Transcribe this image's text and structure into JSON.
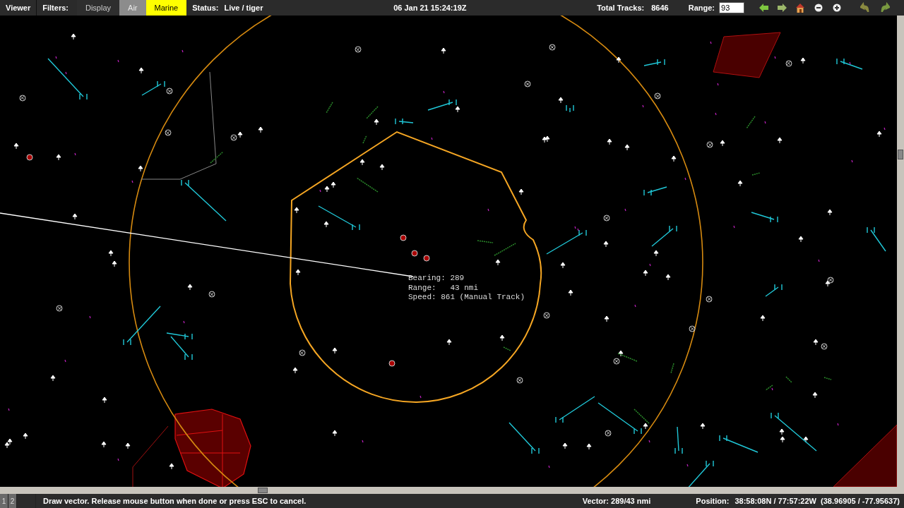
{
  "toolbar": {
    "menu": "Viewer",
    "filters_label": "Filters:",
    "filters": [
      {
        "label": "Display",
        "color": "#2e2e2e"
      },
      {
        "label": "Air",
        "color": "#8c8c8c"
      },
      {
        "label": "Marine",
        "color": "#ffff00"
      }
    ],
    "status_label": "Status:",
    "status": "Live / tiger",
    "datetime": "06 Jan 21 15:24:19Z",
    "tracks_label": "Total Tracks:",
    "tracks": "8646",
    "range_label": "Range:",
    "range": "93"
  },
  "readout": [
    "Bearing: 289",
    "Range:   43 nmi",
    "Speed: 861 (Manual Track)"
  ],
  "status_bar": {
    "pages": [
      "1",
      "2"
    ],
    "message": "Draw vector. Release mouse button when done or press ESC to cancel.",
    "vector": "Vector: 289/43 nmi",
    "position_label": "Position:",
    "position": "38:58:08N / 77:57:22W  (38.96905 / -77.95637)"
  }
}
